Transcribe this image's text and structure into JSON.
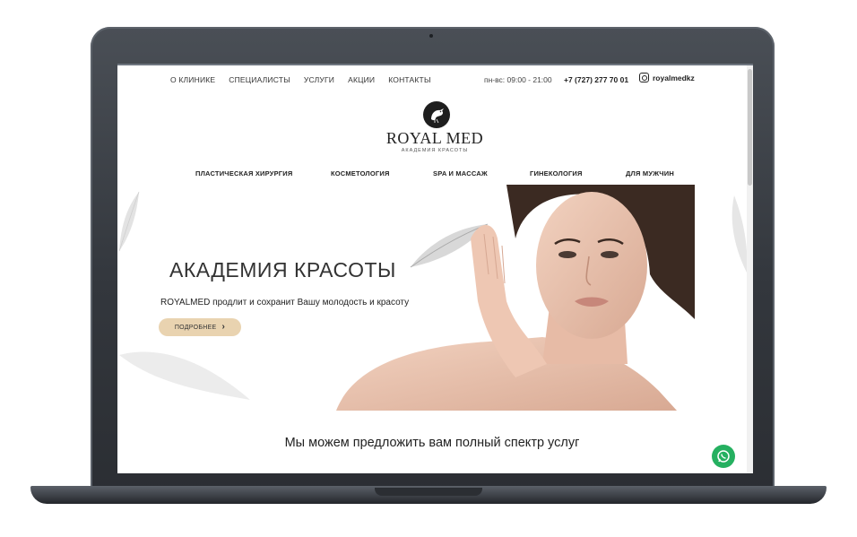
{
  "topbar": {
    "nav": [
      "О КЛИНИКЕ",
      "СПЕЦИАЛИСТЫ",
      "УСЛУГИ",
      "АКЦИИ",
      "КОНТАКТЫ"
    ],
    "hours": "пн-вс: 09:00 - 21:00",
    "phone": "+7 (727) 277 70 01",
    "instagram": "royalmedkz"
  },
  "logo": {
    "title": "ROYAL MED",
    "subtitle": "АКАДЕМИЯ КРАСОТЫ"
  },
  "services": [
    "ПЛАСТИЧЕСКАЯ ХИРУРГИЯ",
    "КОСМЕТОЛОГИЯ",
    "SPA И МАССАЖ",
    "ГИНЕКОЛОГИЯ",
    "ДЛЯ МУЖЧИН"
  ],
  "hero": {
    "title": "АКАДЕМИЯ КРАСОТЫ",
    "subtitle": "ROYALMED продлит и сохранит Вашу молодость и красоту",
    "button": "ПОДРОБНЕЕ"
  },
  "section": {
    "title": "Мы можем предложить вам полный спектр услуг"
  },
  "icons": {
    "logo": "bird-logo-icon",
    "instagram": "instagram-icon",
    "button_arrow": "chevron-right-icon",
    "chat": "whatsapp-icon"
  },
  "colors": {
    "button_bg": "#e9d3b0",
    "whatsapp": "#25b060",
    "frame": "#3a3e44"
  }
}
